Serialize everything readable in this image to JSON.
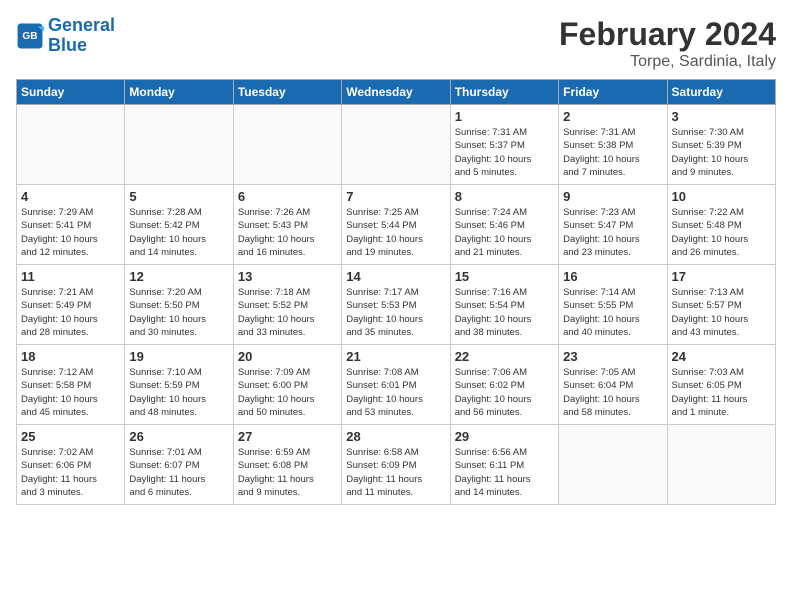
{
  "logo": {
    "line1": "General",
    "line2": "Blue"
  },
  "title": "February 2024",
  "subtitle": "Torpe, Sardinia, Italy",
  "weekdays": [
    "Sunday",
    "Monday",
    "Tuesday",
    "Wednesday",
    "Thursday",
    "Friday",
    "Saturday"
  ],
  "weeks": [
    [
      {
        "day": "",
        "info": ""
      },
      {
        "day": "",
        "info": ""
      },
      {
        "day": "",
        "info": ""
      },
      {
        "day": "",
        "info": ""
      },
      {
        "day": "1",
        "info": "Sunrise: 7:31 AM\nSunset: 5:37 PM\nDaylight: 10 hours\nand 5 minutes."
      },
      {
        "day": "2",
        "info": "Sunrise: 7:31 AM\nSunset: 5:38 PM\nDaylight: 10 hours\nand 7 minutes."
      },
      {
        "day": "3",
        "info": "Sunrise: 7:30 AM\nSunset: 5:39 PM\nDaylight: 10 hours\nand 9 minutes."
      }
    ],
    [
      {
        "day": "4",
        "info": "Sunrise: 7:29 AM\nSunset: 5:41 PM\nDaylight: 10 hours\nand 12 minutes."
      },
      {
        "day": "5",
        "info": "Sunrise: 7:28 AM\nSunset: 5:42 PM\nDaylight: 10 hours\nand 14 minutes."
      },
      {
        "day": "6",
        "info": "Sunrise: 7:26 AM\nSunset: 5:43 PM\nDaylight: 10 hours\nand 16 minutes."
      },
      {
        "day": "7",
        "info": "Sunrise: 7:25 AM\nSunset: 5:44 PM\nDaylight: 10 hours\nand 19 minutes."
      },
      {
        "day": "8",
        "info": "Sunrise: 7:24 AM\nSunset: 5:46 PM\nDaylight: 10 hours\nand 21 minutes."
      },
      {
        "day": "9",
        "info": "Sunrise: 7:23 AM\nSunset: 5:47 PM\nDaylight: 10 hours\nand 23 minutes."
      },
      {
        "day": "10",
        "info": "Sunrise: 7:22 AM\nSunset: 5:48 PM\nDaylight: 10 hours\nand 26 minutes."
      }
    ],
    [
      {
        "day": "11",
        "info": "Sunrise: 7:21 AM\nSunset: 5:49 PM\nDaylight: 10 hours\nand 28 minutes."
      },
      {
        "day": "12",
        "info": "Sunrise: 7:20 AM\nSunset: 5:50 PM\nDaylight: 10 hours\nand 30 minutes."
      },
      {
        "day": "13",
        "info": "Sunrise: 7:18 AM\nSunset: 5:52 PM\nDaylight: 10 hours\nand 33 minutes."
      },
      {
        "day": "14",
        "info": "Sunrise: 7:17 AM\nSunset: 5:53 PM\nDaylight: 10 hours\nand 35 minutes."
      },
      {
        "day": "15",
        "info": "Sunrise: 7:16 AM\nSunset: 5:54 PM\nDaylight: 10 hours\nand 38 minutes."
      },
      {
        "day": "16",
        "info": "Sunrise: 7:14 AM\nSunset: 5:55 PM\nDaylight: 10 hours\nand 40 minutes."
      },
      {
        "day": "17",
        "info": "Sunrise: 7:13 AM\nSunset: 5:57 PM\nDaylight: 10 hours\nand 43 minutes."
      }
    ],
    [
      {
        "day": "18",
        "info": "Sunrise: 7:12 AM\nSunset: 5:58 PM\nDaylight: 10 hours\nand 45 minutes."
      },
      {
        "day": "19",
        "info": "Sunrise: 7:10 AM\nSunset: 5:59 PM\nDaylight: 10 hours\nand 48 minutes."
      },
      {
        "day": "20",
        "info": "Sunrise: 7:09 AM\nSunset: 6:00 PM\nDaylight: 10 hours\nand 50 minutes."
      },
      {
        "day": "21",
        "info": "Sunrise: 7:08 AM\nSunset: 6:01 PM\nDaylight: 10 hours\nand 53 minutes."
      },
      {
        "day": "22",
        "info": "Sunrise: 7:06 AM\nSunset: 6:02 PM\nDaylight: 10 hours\nand 56 minutes."
      },
      {
        "day": "23",
        "info": "Sunrise: 7:05 AM\nSunset: 6:04 PM\nDaylight: 10 hours\nand 58 minutes."
      },
      {
        "day": "24",
        "info": "Sunrise: 7:03 AM\nSunset: 6:05 PM\nDaylight: 11 hours\nand 1 minute."
      }
    ],
    [
      {
        "day": "25",
        "info": "Sunrise: 7:02 AM\nSunset: 6:06 PM\nDaylight: 11 hours\nand 3 minutes."
      },
      {
        "day": "26",
        "info": "Sunrise: 7:01 AM\nSunset: 6:07 PM\nDaylight: 11 hours\nand 6 minutes."
      },
      {
        "day": "27",
        "info": "Sunrise: 6:59 AM\nSunset: 6:08 PM\nDaylight: 11 hours\nand 9 minutes."
      },
      {
        "day": "28",
        "info": "Sunrise: 6:58 AM\nSunset: 6:09 PM\nDaylight: 11 hours\nand 11 minutes."
      },
      {
        "day": "29",
        "info": "Sunrise: 6:56 AM\nSunset: 6:11 PM\nDaylight: 11 hours\nand 14 minutes."
      },
      {
        "day": "",
        "info": ""
      },
      {
        "day": "",
        "info": ""
      }
    ]
  ]
}
